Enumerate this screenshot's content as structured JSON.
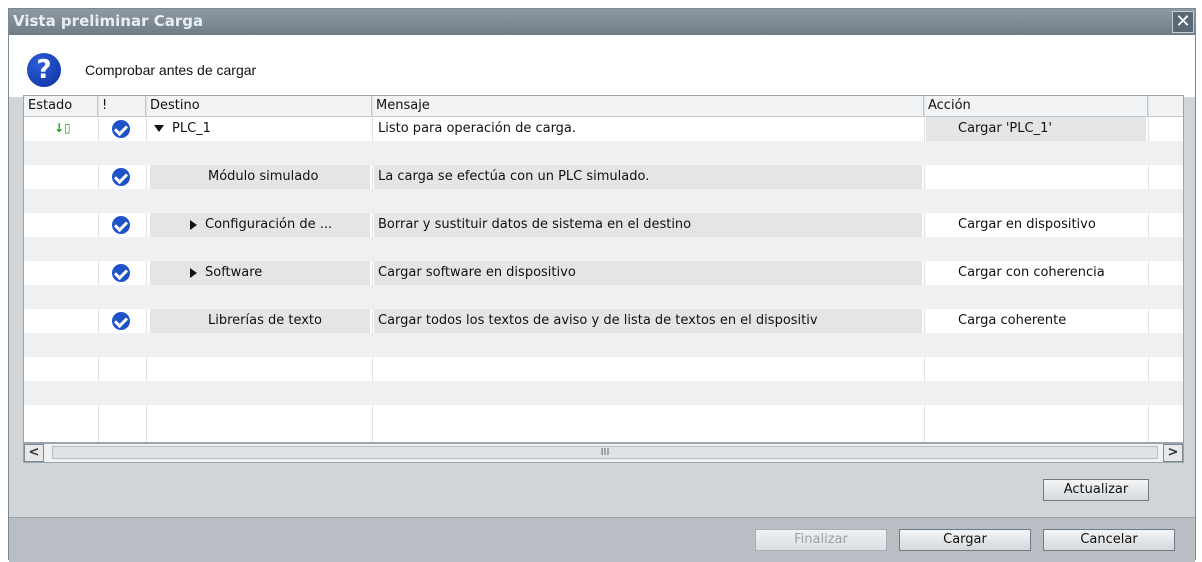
{
  "window": {
    "title": "Vista preliminar Carga",
    "close_label": "✕"
  },
  "header": {
    "text": "Comprobar antes de cargar",
    "icon": "question-icon"
  },
  "table": {
    "columns": [
      "Estado",
      "!",
      "Destino",
      "Mensaje",
      "Acción"
    ],
    "rows": [
      {
        "destino": "PLC_1",
        "mensaje": "Listo para operación de carga.",
        "accion": "Cargar 'PLC_1'"
      },
      {
        "destino": "Módulo simulado",
        "mensaje": "La carga se efectúa con un PLC simulado.",
        "accion": ""
      },
      {
        "destino": "Configuración de ...",
        "mensaje": "Borrar y sustituir datos de sistema en el destino",
        "accion": "Cargar en dispositivo"
      },
      {
        "destino": "Software",
        "mensaje": "Cargar software en dispositivo",
        "accion": "Cargar con coherencia"
      },
      {
        "destino": "Librerías de texto",
        "mensaje": "Cargar todos los textos de aviso y de lista de textos en el dispositiv",
        "accion": "Carga coherente"
      }
    ]
  },
  "scrollbar": {
    "thumb_label": "III"
  },
  "buttons": {
    "actualizar": "Actualizar",
    "finalizar": "Finalizar",
    "cargar": "Cargar",
    "cancelar": "Cancelar"
  },
  "colors": {
    "check": "#1f52c7",
    "title_bar": "#7f8c95"
  }
}
